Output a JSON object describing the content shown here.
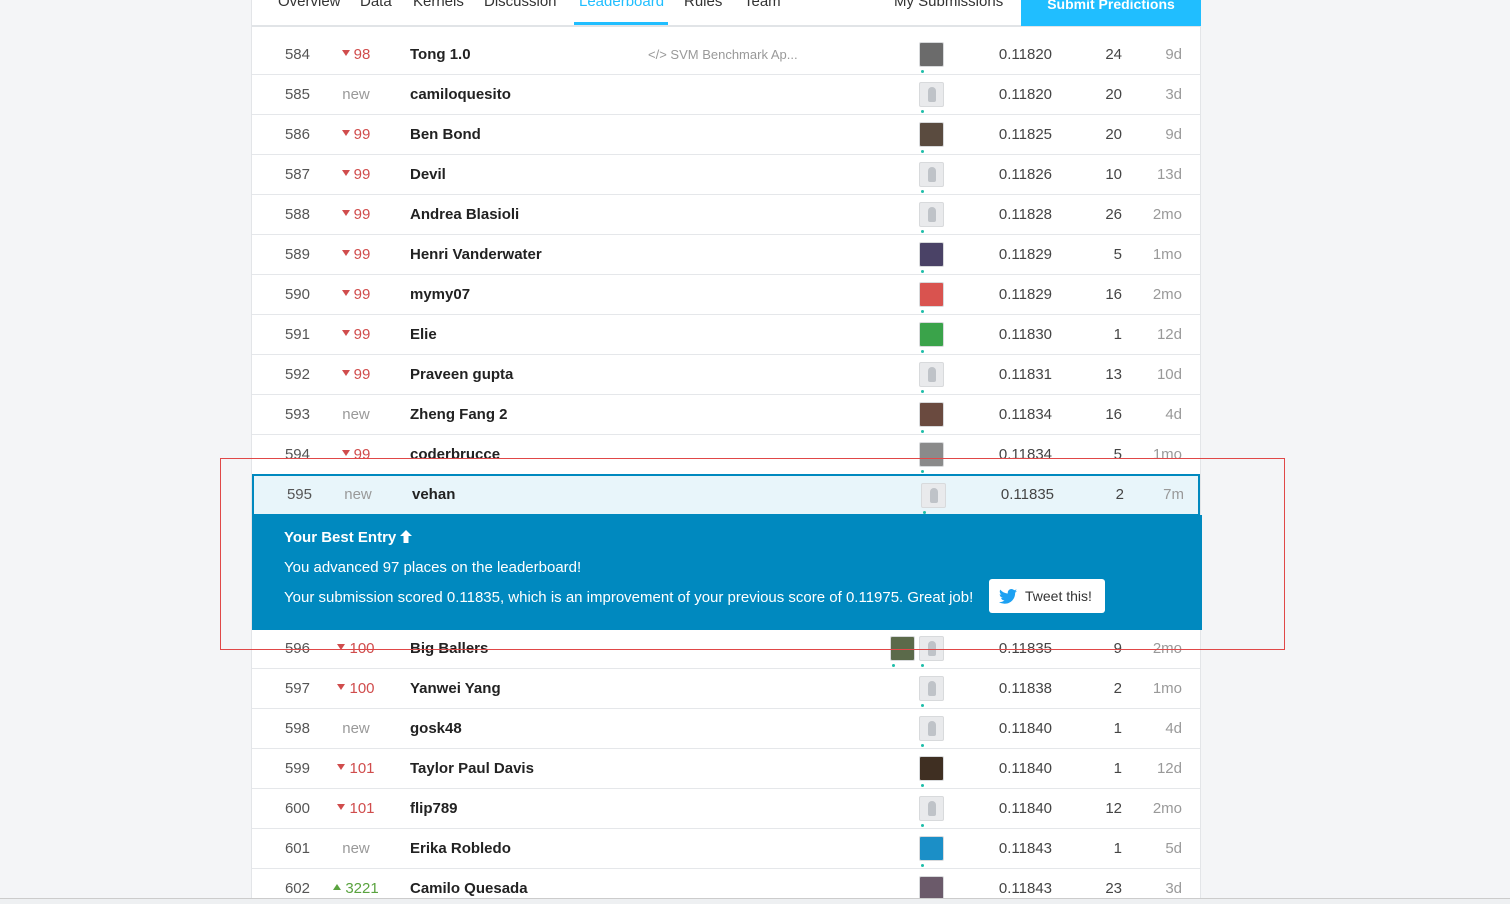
{
  "nav": {
    "tabs": [
      "Overview",
      "Data",
      "Kernels",
      "Discussion",
      "Leaderboard",
      "Rules",
      "Team"
    ],
    "active_tab": "Leaderboard",
    "my_submissions": "My Submissions",
    "submit": "Submit Predictions"
  },
  "rows_before": [
    {
      "rank": "584",
      "delta": "98",
      "dir": "down",
      "team": "Tong 1.0",
      "kernel": "</> SVM Benchmark Ap...",
      "score": "0.11820",
      "entries": "24",
      "last": "9d"
    },
    {
      "rank": "585",
      "delta": "new",
      "dir": "new",
      "team": "camiloquesito",
      "kernel": "",
      "score": "0.11820",
      "entries": "20",
      "last": "3d"
    },
    {
      "rank": "586",
      "delta": "99",
      "dir": "down",
      "team": "Ben Bond",
      "kernel": "",
      "score": "0.11825",
      "entries": "20",
      "last": "9d"
    },
    {
      "rank": "587",
      "delta": "99",
      "dir": "down",
      "team": "Devil",
      "kernel": "",
      "score": "0.11826",
      "entries": "10",
      "last": "13d"
    },
    {
      "rank": "588",
      "delta": "99",
      "dir": "down",
      "team": "Andrea Blasioli",
      "kernel": "",
      "score": "0.11828",
      "entries": "26",
      "last": "2mo"
    },
    {
      "rank": "589",
      "delta": "99",
      "dir": "down",
      "team": "Henri Vanderwater",
      "kernel": "",
      "score": "0.11829",
      "entries": "5",
      "last": "1mo"
    },
    {
      "rank": "590",
      "delta": "99",
      "dir": "down",
      "team": "mymy07",
      "kernel": "",
      "score": "0.11829",
      "entries": "16",
      "last": "2mo"
    },
    {
      "rank": "591",
      "delta": "99",
      "dir": "down",
      "team": "Elie",
      "kernel": "",
      "score": "0.11830",
      "entries": "1",
      "last": "12d"
    },
    {
      "rank": "592",
      "delta": "99",
      "dir": "down",
      "team": "Praveen gupta",
      "kernel": "",
      "score": "0.11831",
      "entries": "13",
      "last": "10d"
    },
    {
      "rank": "593",
      "delta": "new",
      "dir": "new",
      "team": "Zheng Fang 2",
      "kernel": "",
      "score": "0.11834",
      "entries": "16",
      "last": "4d"
    },
    {
      "rank": "594",
      "delta": "99",
      "dir": "down",
      "team": "coderbrucce",
      "kernel": "",
      "score": "0.11834",
      "entries": "5",
      "last": "1mo"
    }
  ],
  "my_row": {
    "rank": "595",
    "delta": "new",
    "dir": "new",
    "team": "vehan",
    "kernel": "",
    "score": "0.11835",
    "entries": "2",
    "last": "7m"
  },
  "banner": {
    "title": "Your Best Entry",
    "line1": "You advanced 97 places on the leaderboard!",
    "line2": "Your submission scored 0.11835, which is an improvement of your previous score of 0.11975. Great job!",
    "tweet": "Tweet this!",
    "icon": "twitter-icon"
  },
  "rows_after": [
    {
      "rank": "596",
      "delta": "100",
      "dir": "down",
      "team": "Big Ballers",
      "kernel": "",
      "score": "0.11835",
      "entries": "9",
      "last": "2mo"
    },
    {
      "rank": "597",
      "delta": "100",
      "dir": "down",
      "team": "Yanwei Yang",
      "kernel": "",
      "score": "0.11838",
      "entries": "2",
      "last": "1mo"
    },
    {
      "rank": "598",
      "delta": "new",
      "dir": "new",
      "team": "gosk48",
      "kernel": "",
      "score": "0.11840",
      "entries": "1",
      "last": "4d"
    },
    {
      "rank": "599",
      "delta": "101",
      "dir": "down",
      "team": "Taylor Paul Davis",
      "kernel": "",
      "score": "0.11840",
      "entries": "1",
      "last": "12d"
    },
    {
      "rank": "600",
      "delta": "101",
      "dir": "down",
      "team": "flip789",
      "kernel": "",
      "score": "0.11840",
      "entries": "12",
      "last": "2mo"
    },
    {
      "rank": "601",
      "delta": "new",
      "dir": "new",
      "team": "Erika Robledo",
      "kernel": "",
      "score": "0.11843",
      "entries": "1",
      "last": "5d"
    },
    {
      "rank": "602",
      "delta": "3221",
      "dir": "up",
      "team": "Camilo Quesada",
      "kernel": "",
      "score": "0.11843",
      "entries": "23",
      "last": "3d"
    }
  ],
  "colors": {
    "accent": "#20beff",
    "banner": "#0089bf",
    "down": "#d04c4c",
    "up": "#5aa33f",
    "highlight_border": "#e04848"
  }
}
